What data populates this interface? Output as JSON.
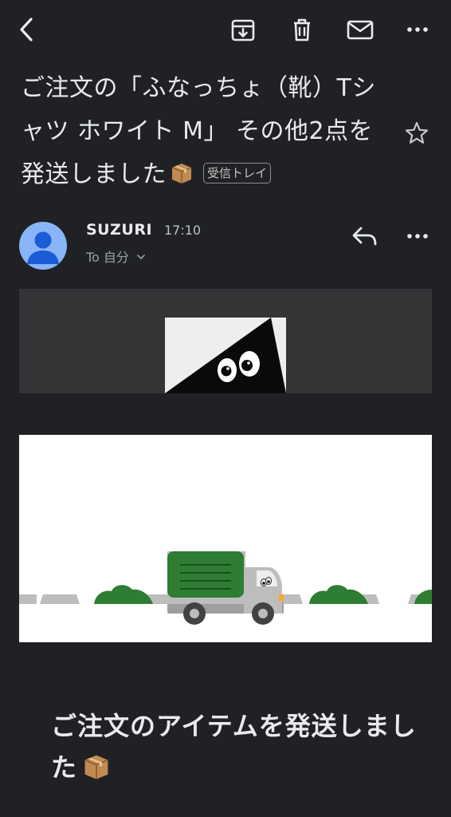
{
  "toolbar": {
    "back_icon": "chevron-left-icon",
    "archive_icon": "archive-icon",
    "delete_icon": "trash-icon",
    "mark_unread_icon": "mail-icon",
    "more_icon": "more-horizontal-icon"
  },
  "subject": {
    "text": "ご注文の「ふなっちょ（靴）Tシャツ ホワイト M」 その他2点を発送しました",
    "emoji": "package-emoji",
    "label": "受信トレイ",
    "star_icon": "star-outline-icon"
  },
  "message": {
    "sender": "SUZURI",
    "time": "17:10",
    "recipient": "To 自分",
    "reply_icon": "reply-icon",
    "more_icon": "more-horizontal-icon"
  },
  "content": {
    "heading": "ご注文のアイテムを発送しました",
    "heading_emoji": "package-emoji"
  },
  "colors": {
    "background": "#202124",
    "banner": "#333436",
    "avatar": "#8ab4f8",
    "truck_green": "#2e7d32",
    "bush_green": "#2e7d32"
  }
}
